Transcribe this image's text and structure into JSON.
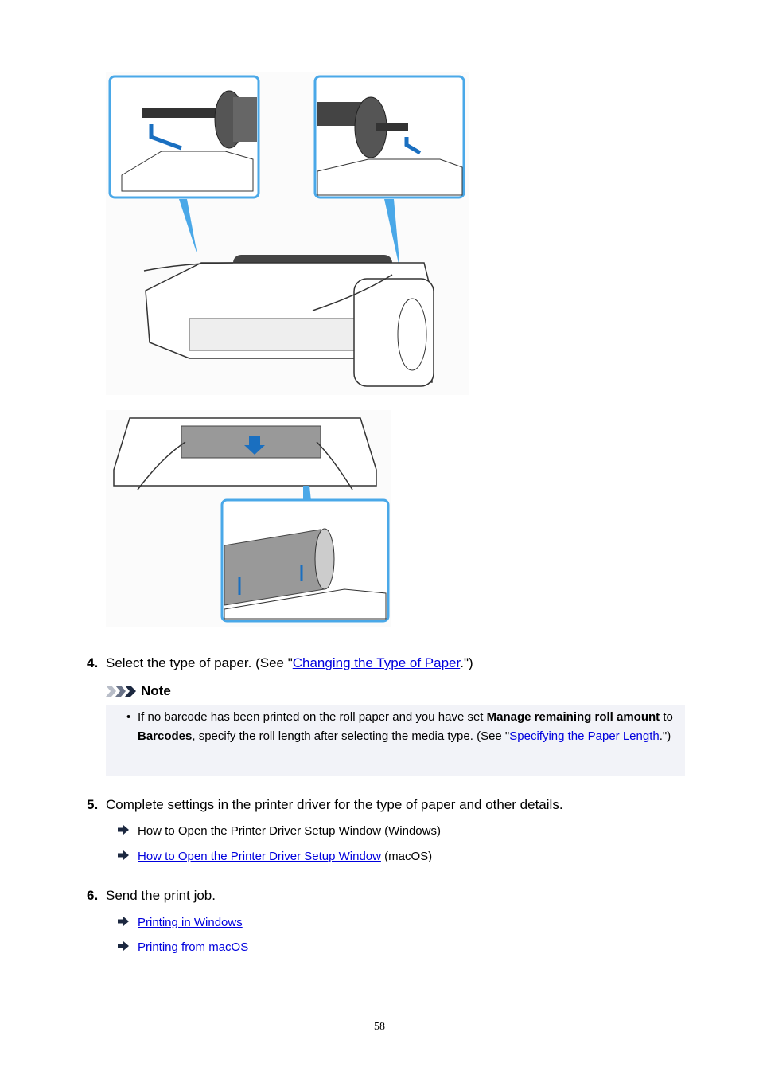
{
  "steps": [
    {
      "number": "4.",
      "text_before": "Select the type of paper. (See \"",
      "link": "Changing the Type of Paper",
      "text_after": ".\")"
    },
    {
      "number": "5.",
      "text": "Complete settings in the printer driver for the type of paper and other details.",
      "links": [
        {
          "link": "",
          "text": "How to Open the Printer Driver Setup Window (Windows)"
        },
        {
          "link": "How to Open the Printer Driver Setup Window",
          "text": " (macOS)"
        }
      ]
    },
    {
      "number": "6.",
      "text": "Send the print job.",
      "links": [
        {
          "link": "Printing in Windows"
        },
        {
          "link": "Printing from macOS"
        }
      ]
    }
  ],
  "note": {
    "heading": "Note",
    "bullet": "•",
    "t1": "If no barcode has been printed on the roll paper and you have set ",
    "b1": "Manage remaining roll amount",
    "t2": " to ",
    "b2": "Barcodes",
    "t3": ", specify the roll length after selecting the media type. (See \"",
    "link": "Specifying the Paper Length",
    "t4": ".\")"
  },
  "page_number": "58",
  "colors": {
    "link": "#0000dd",
    "note_bg": "#f2f3f8",
    "illustration_accent": "#4aa8e8"
  }
}
